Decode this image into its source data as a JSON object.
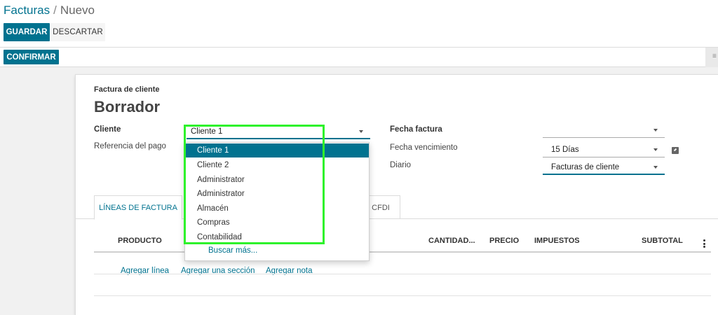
{
  "breadcrumb": {
    "parent": "Facturas",
    "separator": "/",
    "current": "Nuevo"
  },
  "toolbar": {
    "save_label": "GUARDAR",
    "discard_label": "DESCARTAR",
    "confirm_label": "CONFIRMAR",
    "status_end_glyph": "≡"
  },
  "form": {
    "doc_type": "Factura de cliente",
    "title": "Borrador",
    "cliente_label": "Cliente",
    "cliente_value": "Cliente 1",
    "referencia_label": "Referencia del pago",
    "fecha_factura_label": "Fecha factura",
    "fecha_factura_value": "",
    "fecha_vencimiento_label": "Fecha vencimiento",
    "fecha_vencimiento_value": "15 Días",
    "diario_label": "Diario",
    "diario_value": "Facturas de cliente"
  },
  "tabs": {
    "lineas": "LÍNEAS DE FACTURA",
    "cfdi": "CFDI"
  },
  "table": {
    "headers": {
      "producto": "PRODUCTO",
      "cantidad": "CANTIDAD...",
      "precio": "PRECIO",
      "impuestos": "IMPUESTOS",
      "subtotal": "SUBTOTAL"
    },
    "add_line": "Agregar línea",
    "add_section": "Agregar una sección",
    "add_note": "Agregar nota"
  },
  "dropdown": {
    "items": [
      "Cliente 1",
      "Cliente 2",
      "Administrator",
      "Administrator",
      "Almacén",
      "Compras",
      "Contabilidad"
    ],
    "selected_index": 0,
    "search_more": "Buscar más..."
  },
  "colors": {
    "accent": "#00728f",
    "highlight": "#2ef22b"
  }
}
